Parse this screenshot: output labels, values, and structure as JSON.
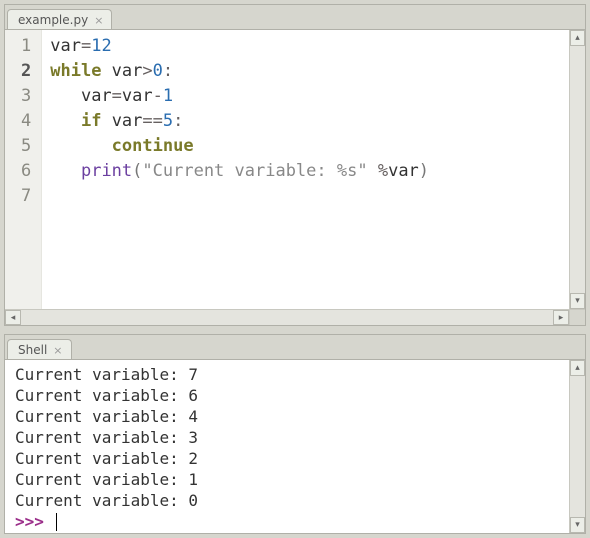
{
  "editor": {
    "tab_label": "example.py",
    "current_line": 2,
    "lines": [
      {
        "n": 1,
        "tokens": [
          [
            "",
            "var"
          ],
          [
            "op",
            "="
          ],
          [
            "num",
            "12"
          ]
        ]
      },
      {
        "n": 2,
        "tokens": [
          [
            "kw",
            "while"
          ],
          [
            "",
            " var"
          ],
          [
            "op",
            ">"
          ],
          [
            "num",
            "0"
          ],
          [
            "op",
            ":"
          ]
        ]
      },
      {
        "n": 3,
        "tokens": [
          [
            "",
            "   var"
          ],
          [
            "op",
            "="
          ],
          [
            "",
            "var"
          ],
          [
            "op",
            "-"
          ],
          [
            "num",
            "1"
          ]
        ]
      },
      {
        "n": 4,
        "tokens": [
          [
            "",
            "   "
          ],
          [
            "kw",
            "if"
          ],
          [
            "",
            " var"
          ],
          [
            "op",
            "=="
          ],
          [
            "num",
            "5"
          ],
          [
            "op",
            ":"
          ]
        ]
      },
      {
        "n": 5,
        "tokens": [
          [
            "",
            "      "
          ],
          [
            "kw",
            "continue"
          ]
        ]
      },
      {
        "n": 6,
        "tokens": [
          [
            "",
            ""
          ]
        ]
      },
      {
        "n": 7,
        "tokens": [
          [
            "",
            "   "
          ],
          [
            "fn",
            "print"
          ],
          [
            "paren",
            "("
          ],
          [
            "strc",
            "\"Current variable: %s\""
          ],
          [
            "",
            " "
          ],
          [
            "op",
            "%"
          ],
          [
            "",
            "var"
          ],
          [
            "paren",
            ")"
          ]
        ]
      }
    ]
  },
  "shell": {
    "tab_label": "Shell",
    "output": [
      "Current variable: 7",
      "Current variable: 6",
      "Current variable: 4",
      "Current variable: 3",
      "Current variable: 2",
      "Current variable: 1",
      "Current variable: 0"
    ],
    "prompt": ">>> "
  }
}
